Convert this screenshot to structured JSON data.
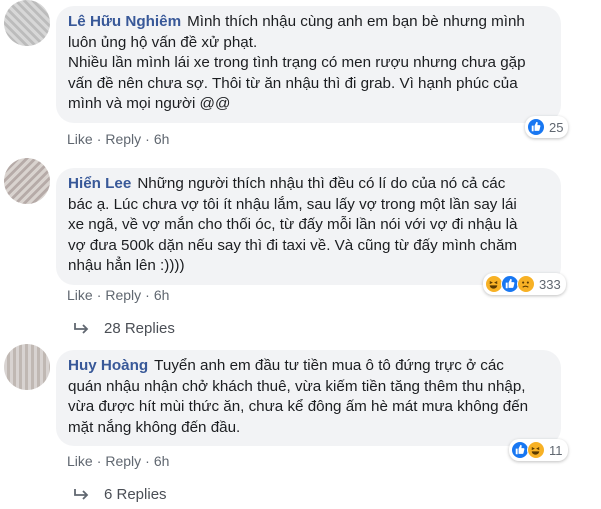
{
  "comments": [
    {
      "author": "Lê Hữu Nghiêm",
      "text": "Mình thích nhậu cùng anh em bạn bè nhưng mình\nluôn ủng hộ vấn đề xử phạt.\nNhiều lần mình lái xe trong tình trạng có men rượu nhưng chưa gặp\nvấn đề nên chưa sợ. Thôi từ ăn nhậu thì đi grab. Vì hạnh phúc của\nmình và mọi người @@",
      "like_label": "Like",
      "reply_label": "Reply",
      "time": "6h",
      "reaction_icons": [
        "like-icon"
      ],
      "reaction_count": "25"
    },
    {
      "author": "Hiển Lee",
      "text": "Những người thích nhậu thì đều có lí do của nó cả các\nbác ạ. Lúc chưa vợ tôi ít nhậu lắm, sau lấy vợ trong một lần say lái\nxe ngã, về vợ mắn cho thối óc, từ đấy mỗi lần nói với vợ đi nhậu là\nvợ đưa 500k dặn nếu say thì đi taxi về. Và cũng từ đấy mình chăm\nnhậu hẳn lên :))))",
      "like_label": "Like",
      "reply_label": "Reply",
      "time": "6h",
      "reaction_icons": [
        "haha-icon",
        "like-icon",
        "sad-icon"
      ],
      "reaction_count": "333",
      "replies_label": "28 Replies"
    },
    {
      "author": "Huy Hoàng",
      "text": "Tuyển anh em đầu tư tiền mua ô tô đứng trực ở các\nquán nhậu nhận chở khách thuê, vừa kiếm tiền tăng thêm thu nhập,\nvừa được hít mùi thức ăn, chưa kể đông ấm hè mát mưa không đến\nmặt nắng không đến đầu.",
      "like_label": "Like",
      "reply_label": "Reply",
      "time": "6h",
      "reaction_icons": [
        "like-icon",
        "haha-icon"
      ],
      "reaction_count": "11",
      "replies_label": "6 Replies"
    }
  ],
  "colors": {
    "author": "#385898",
    "bubble": "#f2f3f5",
    "meta": "#606770",
    "like": "#1877f2",
    "haha": "#f7b125"
  }
}
